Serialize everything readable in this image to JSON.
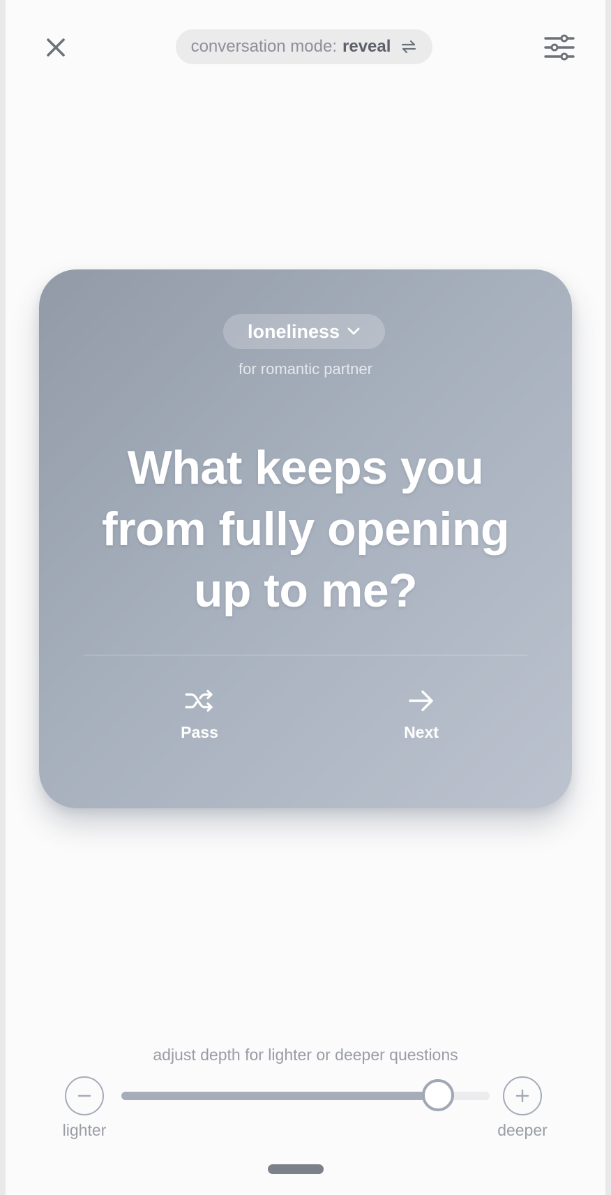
{
  "header": {
    "mode_label": "conversation mode: ",
    "mode_value": "reveal"
  },
  "card": {
    "topic": "loneliness",
    "audience": "for romantic partner",
    "question": "What keeps you from fully opening up to me?",
    "pass_label": "Pass",
    "next_label": "Next"
  },
  "depth": {
    "hint": "adjust depth for lighter or deeper questions",
    "lighter_label": "lighter",
    "deeper_label": "deeper",
    "level_fraction": 0.86
  },
  "icons": {
    "close": "close-icon",
    "swap": "swap-icon",
    "settings": "sliders-icon",
    "topic_dropdown": "chevron-down-icon",
    "pass": "shuffle-icon",
    "next": "arrow-right-icon",
    "minus": "minus-icon",
    "plus": "plus-icon"
  },
  "colors": {
    "card_start": "#929aa8",
    "card_end": "#bcc3cf",
    "slider_fill": "#a5adb9"
  }
}
